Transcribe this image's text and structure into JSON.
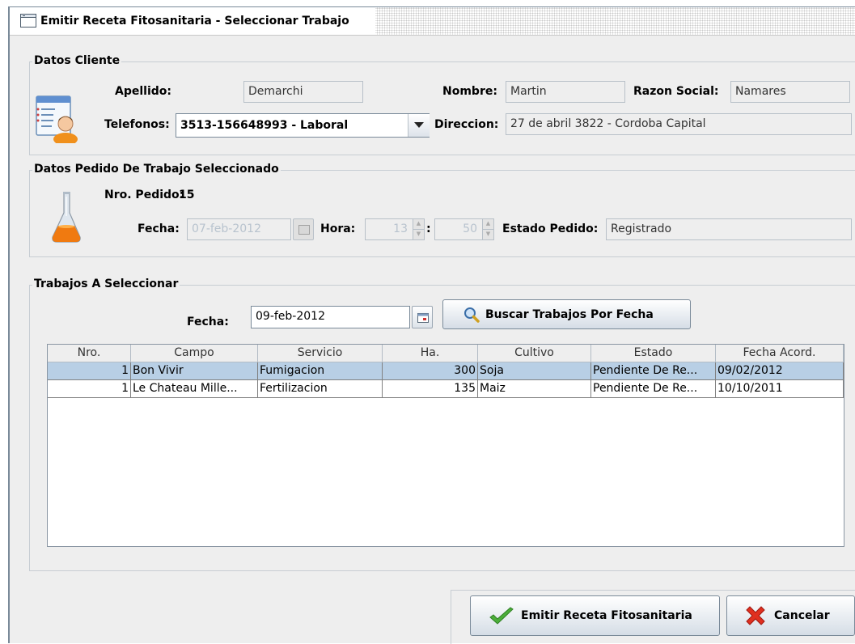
{
  "window": {
    "title": "Emitir Receta Fitosanitaria - Seleccionar Trabajo"
  },
  "cliente": {
    "legend": "Datos Cliente",
    "apellido_label": "Apellido:",
    "apellido": "Demarchi",
    "nombre_label": "Nombre:",
    "nombre": "Martin",
    "razon_label": "Razon Social:",
    "razon": "Namares",
    "telefonos_label": "Telefonos:",
    "telefono_selected": "3513-156648993 - Laboral",
    "direccion_label": "Direccion:",
    "direccion": "27 de abril 3822 - Cordoba Capital",
    "icon": "client-card-icon"
  },
  "pedido": {
    "legend": "Datos Pedido De Trabajo Seleccionado",
    "nro_label": "Nro. Pedido:",
    "nro": "15",
    "fecha_label": "Fecha:",
    "fecha": "07-feb-2012",
    "hora_label": "Hora:",
    "hora": "13",
    "colon": ":",
    "minuto": "50",
    "estado_label": "Estado Pedido:",
    "estado": "Registrado",
    "icon": "flask-icon"
  },
  "trabajos": {
    "legend": "Trabajos A Seleccionar",
    "fecha_label": "Fecha:",
    "fecha": "09-feb-2012",
    "buscar_label": "Buscar Trabajos Por Fecha",
    "columns": [
      "Nro.",
      "Campo",
      "Servicio",
      "Ha.",
      "Cultivo",
      "Estado",
      "Fecha Acord."
    ],
    "rows": [
      [
        "1",
        "Bon Vivir",
        "Fumigacion",
        "300",
        "Soja",
        "Pendiente De Re...",
        "09/02/2012"
      ],
      [
        "1",
        "Le Chateau Mille...",
        "Fertilizacion",
        "135",
        "Maiz",
        "Pendiente De Re...",
        "10/10/2011"
      ]
    ],
    "selected_row": 0
  },
  "actions": {
    "emitir_label": "Emitir Receta Fitosanitaria",
    "cancelar_label": "Cancelar"
  },
  "colors": {
    "selection": "#b8cfe5",
    "panel": "#eeeeee",
    "border": "#7a8a99"
  }
}
